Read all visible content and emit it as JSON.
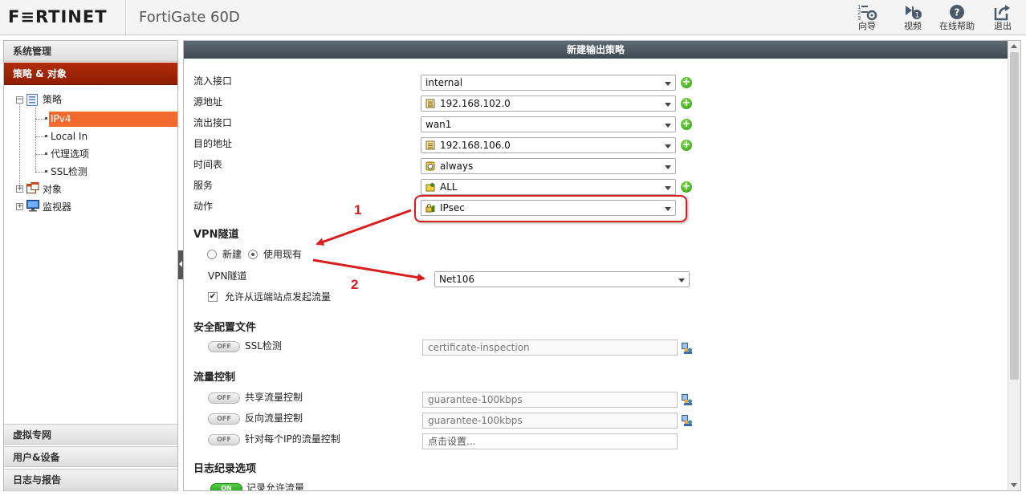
{
  "header": {
    "brand": "F≡RTINET",
    "model": "FortiGate 60D",
    "buttons": [
      {
        "label": "向导",
        "icon": "wizard-icon"
      },
      {
        "label": "视频",
        "icon": "video-icon"
      },
      {
        "label": "在线帮助",
        "icon": "help-icon"
      },
      {
        "label": "退出",
        "icon": "logout-icon"
      }
    ]
  },
  "sidebar": {
    "sections_top": [
      "系统管理",
      "策略 & 对象"
    ],
    "tree": {
      "policy": "策略",
      "children": [
        "IPv4",
        "Local In",
        "代理选项",
        "SSL检测"
      ],
      "objects": "对象",
      "monitor": "监视器"
    },
    "sections_bottom": [
      "虚拟专网",
      "用户&设备",
      "日志与报告"
    ]
  },
  "form": {
    "title": "新建输出策略",
    "fields": {
      "incoming_label": "流入接口",
      "incoming_value": "internal",
      "source_label": "源地址",
      "source_value": "192.168.102.0",
      "outgoing_label": "流出接口",
      "outgoing_value": "wan1",
      "dest_label": "目的地址",
      "dest_value": "192.168.106.0",
      "schedule_label": "时间表",
      "schedule_value": "always",
      "service_label": "服务",
      "service_value": "ALL",
      "action_label": "动作",
      "action_value": "IPsec"
    },
    "vpn": {
      "section": "VPN隧道",
      "radio_new": "新建",
      "radio_existing": "使用现有",
      "tunnel_label": "VPN隧道",
      "tunnel_value": "Net106",
      "allow_remote": "允许从远端站点发起流量"
    },
    "security": {
      "section": "安全配置文件",
      "ssl_label": "SSL检测",
      "ssl_value": "certificate-inspection",
      "ssl_toggle": "OFF"
    },
    "traffic": {
      "section": "流量控制",
      "shared_label": "共享流量控制",
      "shared_value": "guarantee-100kbps",
      "shared_toggle": "OFF",
      "reverse_label": "反向流量控制",
      "reverse_value": "guarantee-100kbps",
      "reverse_toggle": "OFF",
      "perip_label": "针对每个IP的流量控制",
      "perip_placeholder": "点击设置...",
      "perip_toggle": "OFF"
    },
    "log": {
      "section": "日志纪录选项",
      "allowed_label": "记录允许流量",
      "allowed_toggle": "ON"
    }
  },
  "annotations": {
    "step1": "1",
    "step2": "2",
    "color": "#d81e1e"
  },
  "colors": {
    "active_nav": "#a02508",
    "selected_tree": "#f26a2e",
    "title_bar": "#4a565e"
  }
}
